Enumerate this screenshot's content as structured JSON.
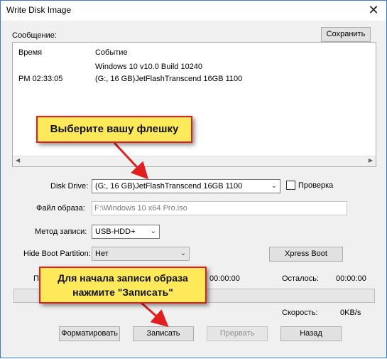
{
  "window": {
    "title": "Write Disk Image",
    "close_glyph": "✕"
  },
  "message": {
    "label": "Сообщение:",
    "save_button": "Сохранить",
    "columns": [
      "Время",
      "Событие"
    ],
    "rows": [
      {
        "time": "",
        "event": "Windows 10 v10.0 Build 10240"
      },
      {
        "time": "PM 02:33:05",
        "event": "(G:, 16 GB)JetFlashTranscend 16GB  1100"
      }
    ]
  },
  "disk_drive": {
    "label": "Disk Drive:",
    "value": "(G:, 16 GB)JetFlashTranscend 16GB  1100",
    "verify_label": "Проверка",
    "verify_checked": false
  },
  "image_file": {
    "label": "Файл образа:",
    "value": "F:\\Windows 10 x64 Pro.iso"
  },
  "write_method": {
    "label": "Метод записи:",
    "value": "USB-HDD+"
  },
  "hide_boot": {
    "label": "Hide Boot Partition:",
    "value": "Нет",
    "xpress_button": "Xpress Boot"
  },
  "progress": {
    "elapsed_prefix": "П",
    "elapsed": "00:00:00",
    "remaining_label": "Осталось:",
    "remaining": "00:00:00",
    "percent": 0,
    "speed_label": "Скорость:",
    "speed": "0KB/s"
  },
  "buttons": {
    "format": "Форматировать",
    "write": "Записать",
    "abort": "Прервать",
    "back": "Назад"
  },
  "callouts": {
    "select_drive": "Выберите вашу флешку",
    "start_write_line1": "Для начала записи образа",
    "start_write_line2": "нажмите \"Записать\""
  },
  "colors": {
    "callout_fill": "#fde95a",
    "callout_border": "#e02020",
    "arrow": "#e02020"
  }
}
